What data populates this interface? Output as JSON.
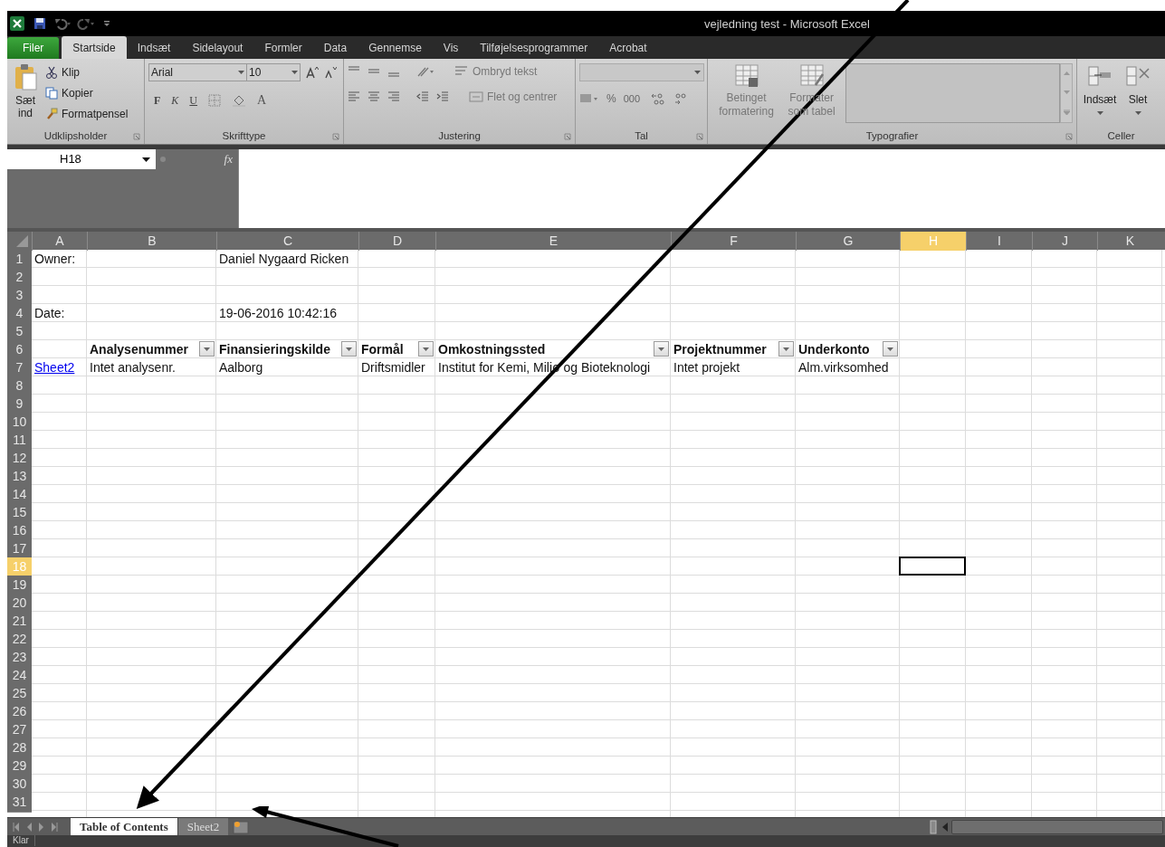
{
  "window": {
    "title": "vejledning test  -  Microsoft Excel"
  },
  "ribbon_tabs": [
    {
      "label": "Filer",
      "kind": "file",
      "selected": false
    },
    {
      "label": "Startside",
      "kind": "tab",
      "selected": true
    },
    {
      "label": "Indsæt",
      "kind": "tab",
      "selected": false
    },
    {
      "label": "Sidelayout",
      "kind": "tab",
      "selected": false
    },
    {
      "label": "Formler",
      "kind": "tab",
      "selected": false
    },
    {
      "label": "Data",
      "kind": "tab",
      "selected": false
    },
    {
      "label": "Gennemse",
      "kind": "tab",
      "selected": false
    },
    {
      "label": "Vis",
      "kind": "tab",
      "selected": false
    },
    {
      "label": "Tilføjelsesprogrammer",
      "kind": "tab",
      "selected": false
    },
    {
      "label": "Acrobat",
      "kind": "tab",
      "selected": false
    }
  ],
  "ribbon": {
    "clipboard": {
      "paste": "Sæt ind",
      "cut": "Klip",
      "copy": "Kopier",
      "format_painter": "Formatpensel",
      "label": "Udklipsholder"
    },
    "font": {
      "font_name": "Arial",
      "font_size": "10",
      "bold": "F",
      "italic": "K",
      "underline": "U",
      "font_color": "A",
      "label": "Skrifttype"
    },
    "alignment": {
      "wrap_text": "Ombryd tekst",
      "merge": "Flet og centrer",
      "label": "Justering"
    },
    "number": {
      "percent": "%",
      "thousands": "000",
      "label": "Tal"
    },
    "styles": {
      "conditional": "Betinget formatering",
      "format_table": "Formater som tabel",
      "label": "Typografier"
    },
    "cells": {
      "insert": "Indsæt",
      "delete": "Slet",
      "label": "Celler"
    }
  },
  "formula_bar": {
    "name_box": "H18",
    "function_button": "fx"
  },
  "sheet": {
    "columns": [
      {
        "label": "A",
        "selected": false
      },
      {
        "label": "B",
        "selected": false
      },
      {
        "label": "C",
        "selected": false
      },
      {
        "label": "D",
        "selected": false
      },
      {
        "label": "E",
        "selected": false
      },
      {
        "label": "F",
        "selected": false
      },
      {
        "label": "G",
        "selected": false
      },
      {
        "label": "H",
        "selected": true
      },
      {
        "label": "I",
        "selected": false
      },
      {
        "label": "J",
        "selected": false
      },
      {
        "label": "K",
        "selected": false
      }
    ],
    "rows": [
      {
        "number": "1",
        "selected": false,
        "cells": {
          "A": {
            "kind": "text",
            "text": "Owner:"
          },
          "C": {
            "kind": "text",
            "text": "Daniel Nygaard Ricken"
          }
        }
      },
      {
        "number": "2",
        "selected": false
      },
      {
        "number": "3",
        "selected": false
      },
      {
        "number": "4",
        "selected": false,
        "cells": {
          "A": {
            "kind": "text",
            "text": "Date:"
          },
          "C": {
            "kind": "text",
            "text": "19-06-2016 10:42:16"
          }
        }
      },
      {
        "number": "5",
        "selected": false
      },
      {
        "number": "6",
        "selected": false,
        "cells": {
          "B": {
            "kind": "header",
            "text": "Analysenummer"
          },
          "C": {
            "kind": "header",
            "text": "Finansieringskilde"
          },
          "D": {
            "kind": "header",
            "text": "Formål"
          },
          "E": {
            "kind": "header",
            "text": "Omkostningssted"
          },
          "F": {
            "kind": "header",
            "text": "Projektnummer"
          },
          "G": {
            "kind": "header",
            "text": "Underkonto"
          }
        }
      },
      {
        "number": "7",
        "selected": false,
        "cells": {
          "A": {
            "kind": "link",
            "text": "Sheet2"
          },
          "B": {
            "kind": "text",
            "text": "Intet analysenr."
          },
          "C": {
            "kind": "text",
            "text": "Aalborg"
          },
          "D": {
            "kind": "text",
            "text": "Driftsmidler"
          },
          "E": {
            "kind": "text",
            "text": "Institut for Kemi, Miljø og Bioteknologi"
          },
          "F": {
            "kind": "text",
            "text": "Intet projekt"
          },
          "G": {
            "kind": "text",
            "text": "Alm.virksomhed"
          }
        }
      },
      {
        "number": "8",
        "selected": false
      },
      {
        "number": "9",
        "selected": false
      },
      {
        "number": "10",
        "selected": false
      },
      {
        "number": "11",
        "selected": false
      },
      {
        "number": "12",
        "selected": false
      },
      {
        "number": "13",
        "selected": false
      },
      {
        "number": "14",
        "selected": false
      },
      {
        "number": "15",
        "selected": false
      },
      {
        "number": "16",
        "selected": false
      },
      {
        "number": "17",
        "selected": false
      },
      {
        "number": "18",
        "selected": true
      },
      {
        "number": "19",
        "selected": false
      },
      {
        "number": "20",
        "selected": false
      },
      {
        "number": "21",
        "selected": false
      },
      {
        "number": "22",
        "selected": false
      },
      {
        "number": "23",
        "selected": false
      },
      {
        "number": "24",
        "selected": false
      },
      {
        "number": "25",
        "selected": false
      },
      {
        "number": "26",
        "selected": false
      },
      {
        "number": "27",
        "selected": false
      },
      {
        "number": "28",
        "selected": false
      },
      {
        "number": "29",
        "selected": false
      },
      {
        "number": "30",
        "selected": false
      },
      {
        "number": "31",
        "selected": false
      }
    ]
  },
  "sheet_tabs": [
    {
      "label": "Table of Contents",
      "selected": true
    },
    {
      "label": "Sheet2",
      "selected": false
    }
  ],
  "status_bar": {
    "text": "Klar"
  }
}
